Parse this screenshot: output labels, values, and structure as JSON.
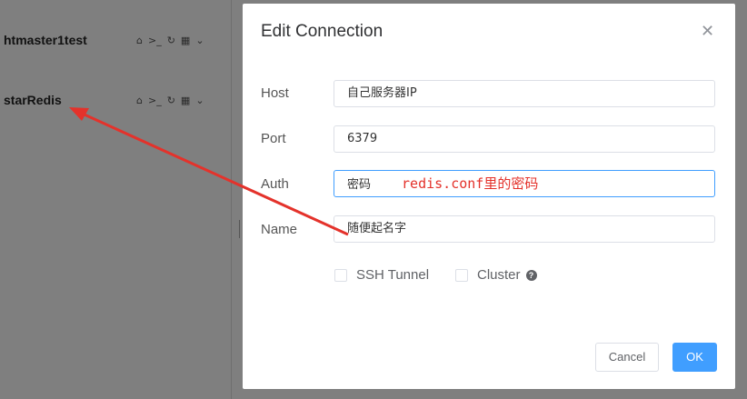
{
  "sidebar": {
    "connections": [
      {
        "name": "htmaster1test"
      },
      {
        "name": "starRedis"
      }
    ]
  },
  "dialog": {
    "title": "Edit Connection",
    "close_icon": "close-icon",
    "fields": {
      "host": {
        "label": "Host",
        "value": "自己服务器IP"
      },
      "port": {
        "label": "Port",
        "value": "6379"
      },
      "auth": {
        "label": "Auth",
        "value": "密码",
        "annotation": "redis.conf里的密码"
      },
      "name": {
        "label": "Name",
        "value": "随便起名字"
      }
    },
    "options": {
      "ssh_tunnel": "SSH Tunnel",
      "cluster": "Cluster"
    },
    "buttons": {
      "cancel": "Cancel",
      "ok": "OK"
    }
  },
  "colors": {
    "overlay": "#7f7f7f",
    "primary": "#409eff",
    "annotation": "#e4322b"
  }
}
